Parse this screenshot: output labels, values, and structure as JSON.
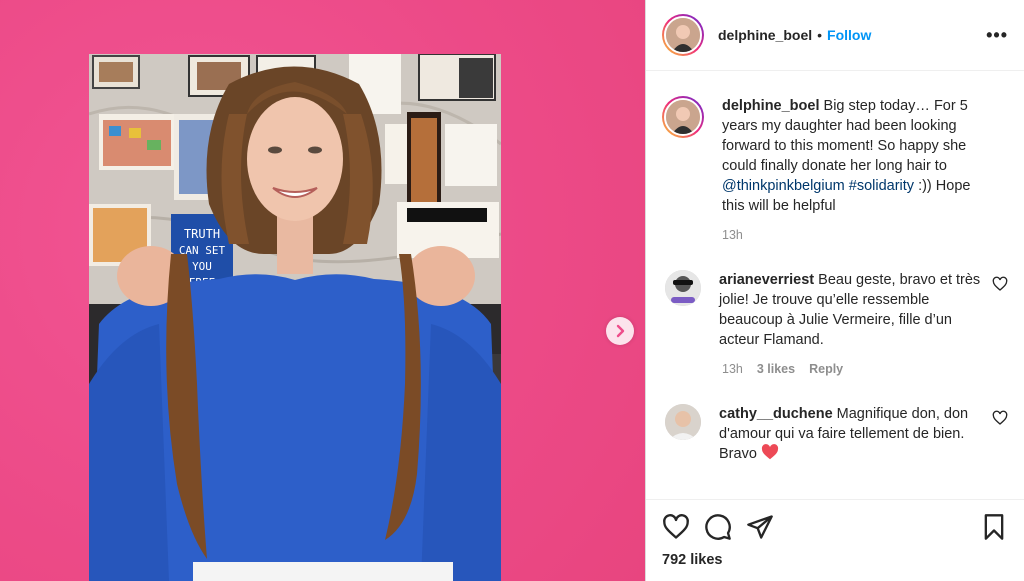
{
  "post": {
    "username": "delphine_boel",
    "follow_label": "Follow",
    "separator": "•",
    "more_label": "•••",
    "likes": "792 likes"
  },
  "caption": {
    "username": "delphine_boel",
    "text_before": " Big step today… For 5 years my daughter had been looking forward to this moment! So happy she could finally donate her long hair to ",
    "mention": "@thinkpinkbelgium",
    "space": " ",
    "hashtag": "#solidarity",
    "text_after": " :)) Hope this will be helpful",
    "time": "13h"
  },
  "comments": [
    {
      "username": "arianeverriest",
      "text": " Beau geste, bravo et très jolie! Je trouve qu’elle ressemble beaucoup à Julie Vermeire, fille d’un acteur Flamand.",
      "time": "13h",
      "likes": "3 likes",
      "reply": "Reply"
    },
    {
      "username": "cathy__duchene",
      "text": " Magnifique don, don d'amour qui va faire tellement de bien. Bravo "
    }
  ],
  "photo_sign": [
    "TRUTH",
    "CAN SET",
    "YOU",
    "FREE"
  ],
  "colors": {
    "background": "#ee4d8b",
    "link": "#0095f6",
    "mention": "#00376b",
    "heart": "#ed4956"
  }
}
